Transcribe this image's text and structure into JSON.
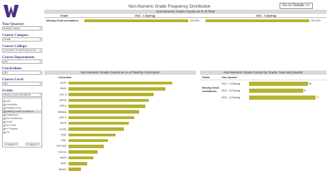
{
  "page": {
    "title": "Non-Numeric Grade Frequency Distribution",
    "goto_label": "Go to Details >>"
  },
  "colors": {
    "bar": "#b5b32f",
    "brand_purple": "#4b2e83",
    "header_bg": "#d9d9d9"
  },
  "filters": {
    "year_quarter": {
      "label": "Year Quarter:",
      "value": "(Multiple values)"
    },
    "campus": {
      "label": "Course Campus:",
      "value": "Seattle"
    },
    "college": {
      "label": "Course College:",
      "value": "COLLEGE OF ARTS AND SCIE..."
    },
    "department": {
      "label": "Course Department:",
      "value": "(All)"
    },
    "curriculum": {
      "label": "Curriculum:",
      "value": "(All)"
    },
    "level": {
      "label": "Course Level:",
      "value": "(All)"
    },
    "grade": {
      "label": "Grade:",
      "value": "Missing Grade Annotations",
      "options": [
        "(All)",
        "Incomplete",
        "Registrar Drop",
        "Missing Grade Annotations",
        "Satisfactory",
        "Not Satisfactory",
        "Credit",
        "No Credit",
        "In Progress",
        "Hw"
      ],
      "apply_label": "Apply",
      "cancel_label": "Cancel"
    }
  },
  "top_panel": {
    "header": "Non-Numeric Grade Counts as % of Total",
    "col_grade": "Grade",
    "periods": [
      "2021 - 2 (Spring)",
      "2021 - 3 (Spring)"
    ],
    "row_label": "Missing Grade Annotations",
    "values": [
      100,
      100
    ],
    "value_labels": [
      "100.00%",
      "100.00%"
    ]
  },
  "bottom_left": {
    "header": "Non-Numeric Grade Counts as % of Total by Curriculum",
    "col_label": "Curriculum",
    "categories": [
      "ASTR",
      "ENGL",
      "POL S",
      "ARTHI",
      "JSIS A",
      "DRAMA",
      "ART H",
      "PHYS",
      "ECON",
      "STAT",
      "PHIL",
      "HSTCMP",
      "PSYCH",
      "MATH",
      "BIOL",
      "MUSIC"
    ],
    "values": [
      100,
      93,
      82,
      77,
      74,
      68,
      63,
      58,
      53,
      45,
      38,
      34,
      28,
      24,
      18,
      12
    ]
  },
  "bottom_right": {
    "header": "Non-Numeric Grade Counts by Grade, Year and Quarter",
    "col_grade": "Grade",
    "col_quarter": "Year Quarter",
    "grade_label": "Missing Grade Annotations",
    "periods": [
      "2021 - 2 (Spring)",
      "2021 - 3 (Spring)",
      "2021 - 3 (Spring)"
    ],
    "values": [
      68,
      62,
      77
    ],
    "value_labels": [
      "68",
      "62",
      "77"
    ]
  }
}
